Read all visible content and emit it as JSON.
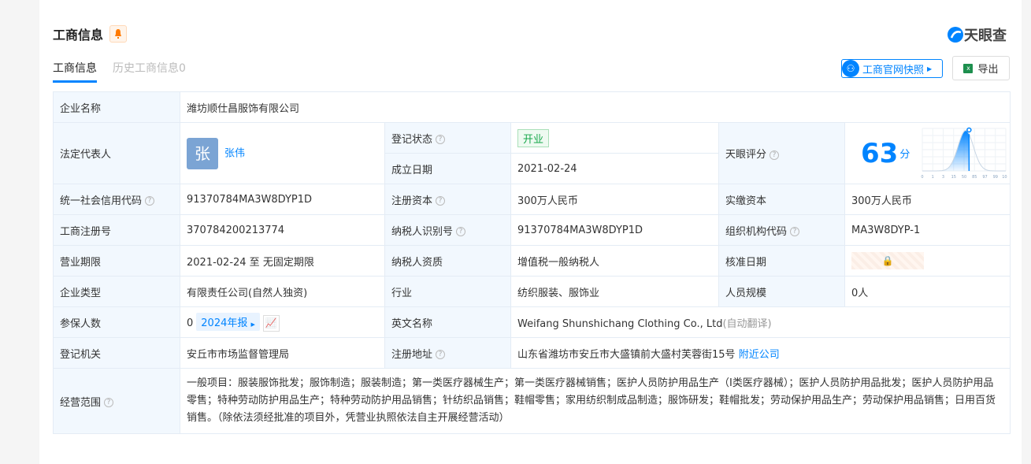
{
  "header": {
    "title": "工商信息",
    "logo_text": "天眼查"
  },
  "tabs": [
    {
      "label": "工商信息"
    },
    {
      "label": "历史工商信息0"
    }
  ],
  "actions": {
    "snapshot": "工商官网快照",
    "export": "导出"
  },
  "company": {
    "name_label": "企业名称",
    "name": "潍坊顺仕昌服饰有限公司",
    "legal_label": "法定代表人",
    "legal_avatar": "张",
    "legal_name": "张伟",
    "status_label": "登记状态",
    "status": "开业",
    "found_label": "成立日期",
    "found": "2021-02-24",
    "score_label": "天眼评分",
    "score": "63",
    "score_unit": "分",
    "credit_label": "统一社会信用代码",
    "credit": "91370784MA3W8DYP1D",
    "capital_label": "注册资本",
    "capital": "300万人民币",
    "paid_label": "实缴资本",
    "paid": "300万人民币",
    "reg_label": "工商注册号",
    "reg": "370784200213774",
    "tax_label": "纳税人识别号",
    "tax": "91370784MA3W8DYP1D",
    "org_label": "组织机构代码",
    "org": "MA3W8DYP-1",
    "term_label": "营业期限",
    "term": "2021-02-24 至 无固定期限",
    "taxq_label": "纳税人资质",
    "taxq": "增值税一般纳税人",
    "approve_label": "核准日期",
    "type_label": "企业类型",
    "type": "有限责任公司(自然人独资)",
    "industry_label": "行业",
    "industry": "纺织服装、服饰业",
    "staff_label": "人员规模",
    "staff": "0人",
    "insured_label": "参保人数",
    "insured": "0",
    "report": "2024年报",
    "en_label": "英文名称",
    "en": "Weifang Shunshichang Clothing Co., Ltd",
    "en_note": "(自动翻译)",
    "authority_label": "登记机关",
    "authority": "安丘市市场监督管理局",
    "addr_label": "注册地址",
    "addr": "山东省潍坊市安丘市大盛镇前大盛村芙蓉街15号",
    "nearby": "附近公司",
    "scope_label": "经营范围",
    "scope": "一般项目：服装服饰批发；服饰制造；服装制造；第一类医疗器械生产；第一类医疗器械销售；医护人员防护用品生产（Ⅰ类医疗器械）；医护人员防护用品批发；医护人员防护用品零售；特种劳动防护用品生产；特种劳动防护用品销售；针纺织品销售；鞋帽零售；家用纺织制成品制造；服饰研发；鞋帽批发；劳动保护用品生产；劳动保护用品销售；日用百货销售。（除依法须经批准的项目外，凭营业执照依法自主开展经营活动）"
  },
  "chart_data": {
    "type": "area",
    "x_ticks": [
      "0",
      "1",
      "3",
      "15",
      "50",
      "85",
      "97",
      "99",
      "100"
    ],
    "marker_score": 63,
    "colors": {
      "accent": "#0084ff"
    }
  }
}
